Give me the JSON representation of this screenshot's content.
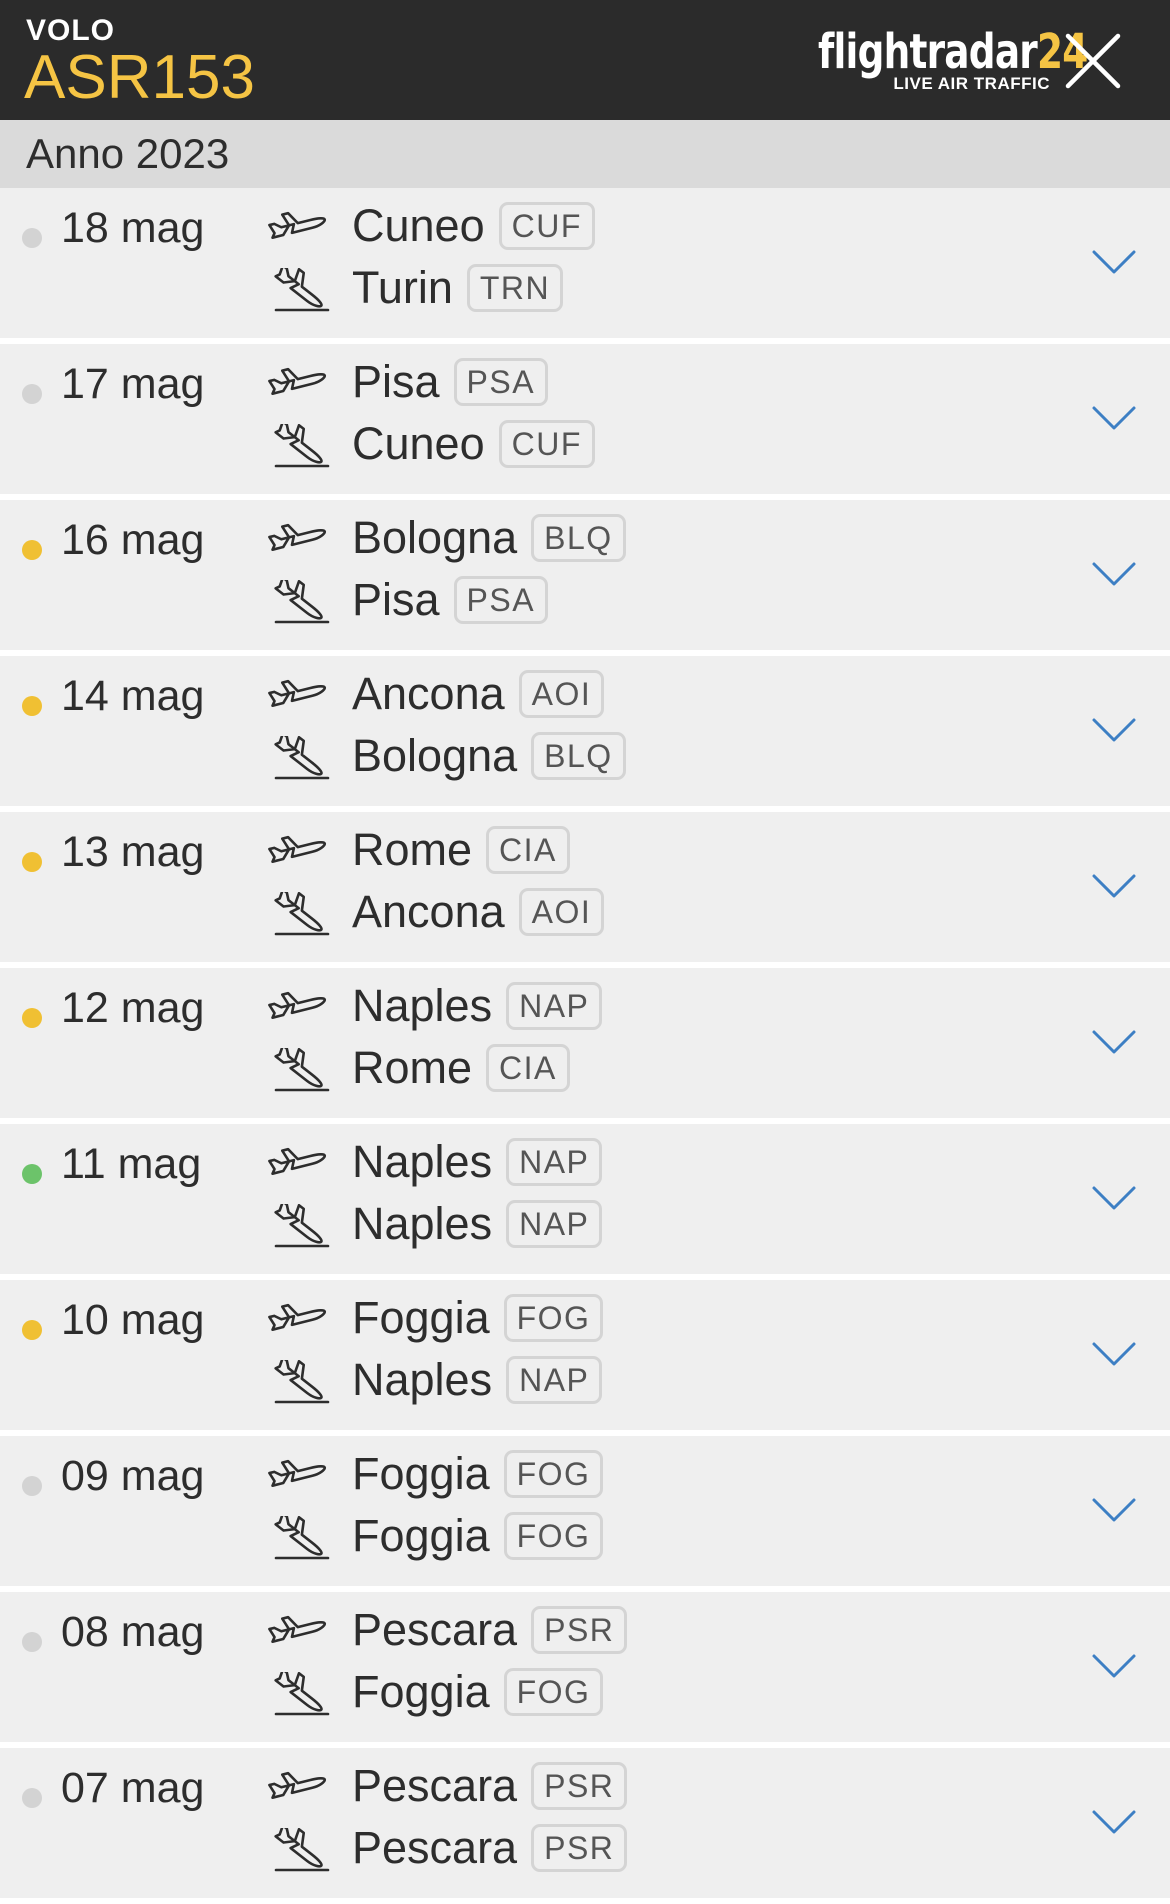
{
  "header": {
    "label": "VOLO",
    "flight_code": "ASR153",
    "logo_main": "flightradar",
    "logo_num": "24",
    "logo_sub": "LIVE AIR TRAFFIC",
    "close_icon": "close-icon"
  },
  "year_label": "Anno 2023",
  "status_colors": {
    "grey": "#d3d3d3",
    "yellow": "#f0c033",
    "green": "#6cc36a"
  },
  "accent_color": "#3d7fc4",
  "flights": [
    {
      "date": "18 mag",
      "status": "grey",
      "from_city": "Cuneo",
      "from_code": "CUF",
      "to_city": "Turin",
      "to_code": "TRN"
    },
    {
      "date": "17 mag",
      "status": "grey",
      "from_city": "Pisa",
      "from_code": "PSA",
      "to_city": "Cuneo",
      "to_code": "CUF"
    },
    {
      "date": "16 mag",
      "status": "yellow",
      "from_city": "Bologna",
      "from_code": "BLQ",
      "to_city": "Pisa",
      "to_code": "PSA"
    },
    {
      "date": "14 mag",
      "status": "yellow",
      "from_city": "Ancona",
      "from_code": "AOI",
      "to_city": "Bologna",
      "to_code": "BLQ"
    },
    {
      "date": "13 mag",
      "status": "yellow",
      "from_city": "Rome",
      "from_code": "CIA",
      "to_city": "Ancona",
      "to_code": "AOI"
    },
    {
      "date": "12 mag",
      "status": "yellow",
      "from_city": "Naples",
      "from_code": "NAP",
      "to_city": "Rome",
      "to_code": "CIA"
    },
    {
      "date": "11 mag",
      "status": "green",
      "from_city": "Naples",
      "from_code": "NAP",
      "to_city": "Naples",
      "to_code": "NAP"
    },
    {
      "date": "10 mag",
      "status": "yellow",
      "from_city": "Foggia",
      "from_code": "FOG",
      "to_city": "Naples",
      "to_code": "NAP"
    },
    {
      "date": "09 mag",
      "status": "grey",
      "from_city": "Foggia",
      "from_code": "FOG",
      "to_city": "Foggia",
      "to_code": "FOG"
    },
    {
      "date": "08 mag",
      "status": "grey",
      "from_city": "Pescara",
      "from_code": "PSR",
      "to_city": "Foggia",
      "to_code": "FOG"
    },
    {
      "date": "07 mag",
      "status": "grey",
      "from_city": "Pescara",
      "from_code": "PSR",
      "to_city": "Pescara",
      "to_code": "PSR"
    }
  ]
}
